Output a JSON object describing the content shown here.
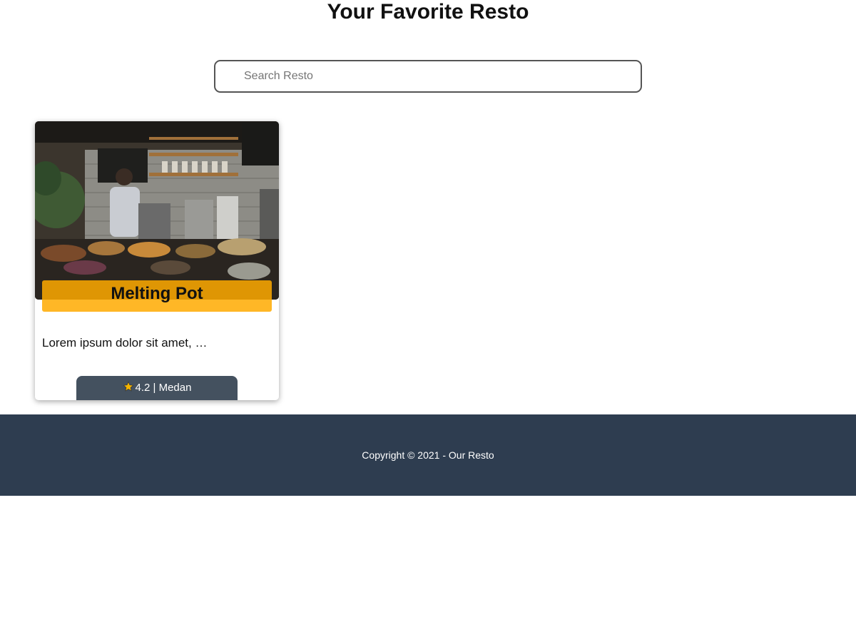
{
  "header": {
    "title": "Your Favorite Resto"
  },
  "search": {
    "placeholder": "Search Resto",
    "value": ""
  },
  "restaurants": [
    {
      "name": "Melting Pot",
      "description": "Lorem ipsum dolor sit amet, …",
      "rating": "4.2",
      "city": "Medan",
      "meta_text": "4.2 | Medan",
      "icons": {
        "rating": "star-icon"
      }
    }
  ],
  "footer": {
    "text": "Copyright © 2021 - Our Resto"
  },
  "colors": {
    "name_banner": "#ffaa00",
    "meta_badge": "#44515f",
    "footer_bg": "#2e3d50",
    "star": "#f5b400"
  }
}
